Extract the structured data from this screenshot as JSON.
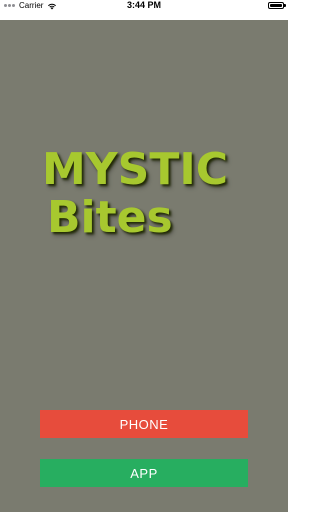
{
  "status_bar": {
    "carrier": "Carrier",
    "time": "3:44 PM",
    "signal_icon": "signal-dots-icon",
    "wifi_icon": "wifi-icon",
    "battery_icon": "battery-icon",
    "battery_level": 1.0
  },
  "logo": {
    "line1": "MYSTIC",
    "line2": "Bites",
    "color": "#a7c82f"
  },
  "buttons": {
    "phone_label": "PHONE",
    "app_label": "APP",
    "phone_color": "#e74c3c",
    "app_color": "#27ae60"
  },
  "theme": {
    "background": "#7a7b6f"
  }
}
